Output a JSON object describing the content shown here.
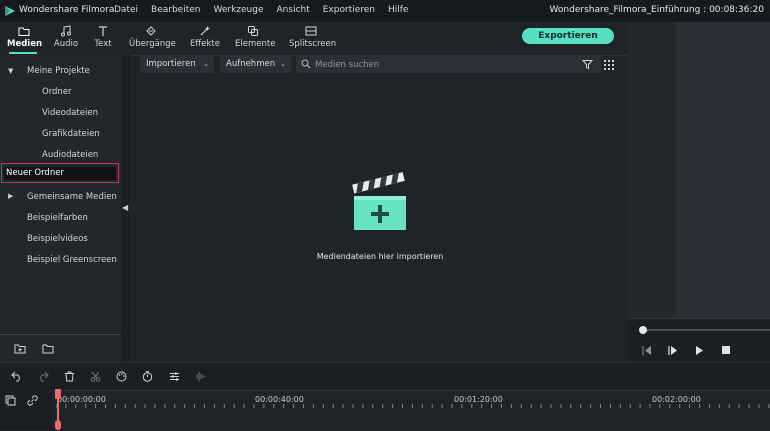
{
  "titlebar": {
    "app_name": "Wondershare Filmora",
    "menu": [
      "Datei",
      "Bearbeiten",
      "Werkzeuge",
      "Ansicht",
      "Exportieren",
      "Hilfe"
    ],
    "project_title": "Wondershare_Filmora_Einführung : 00:08:36:20"
  },
  "modules": {
    "items": [
      {
        "label": "Medien",
        "icon": "folder-icon"
      },
      {
        "label": "Audio",
        "icon": "music-note-icon"
      },
      {
        "label": "Text",
        "icon": "text-icon"
      },
      {
        "label": "Übergänge",
        "icon": "transition-icon"
      },
      {
        "label": "Effekte",
        "icon": "effects-icon"
      },
      {
        "label": "Elemente",
        "icon": "elements-icon"
      },
      {
        "label": "Splitscreen",
        "icon": "splitscreen-icon"
      }
    ],
    "active": "Medien",
    "export_label": "Exportieren"
  },
  "sidebar": {
    "project_root": "Meine Projekte",
    "project_children": [
      "Ordner",
      "Videodateien",
      "Grafikdateien",
      "Audiodateien"
    ],
    "rename_value": "Neuer Ordner",
    "other_items": [
      "Gemeinsame Medien",
      "Beispielfarben",
      "Beispielvideos",
      "Beispiel Greenscreen"
    ]
  },
  "media": {
    "import_label": "Importieren",
    "record_label": "Aufnehmen",
    "search_placeholder": "Medien suchen",
    "empty_text": "Mediendateien hier importieren"
  },
  "timeline": {
    "ruler_labels": [
      "00:00:00:00",
      "00:00:40:00",
      "00:01:20:00",
      "00:02:00:00"
    ]
  },
  "colors": {
    "accent": "#55e0c3",
    "playhead": "#ef6a6a",
    "rename_border": "#c43a5a"
  }
}
